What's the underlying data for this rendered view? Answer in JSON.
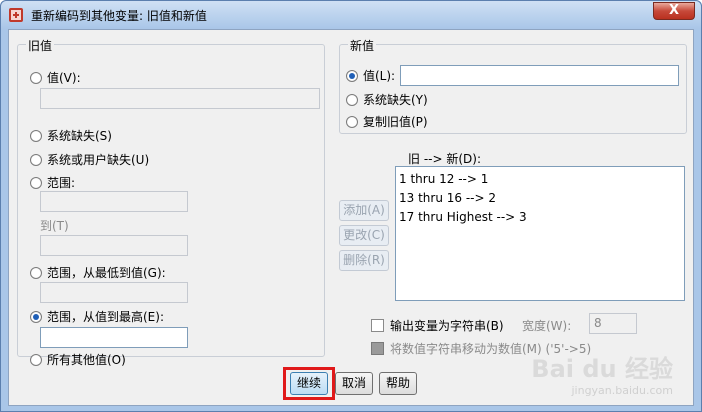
{
  "window": {
    "title": "重新编码到其他变量: 旧值和新值",
    "close_glyph": "X"
  },
  "old_value": {
    "group_title": "旧值",
    "value_label": "值(V):",
    "system_missing_label": "系统缺失(S)",
    "system_or_user_missing_label": "系统或用户缺失(U)",
    "range_label": "范围:",
    "to_label": "到(T)",
    "range_lowest_label": "范围，从最低到值(G):",
    "range_highest_label": "范围，从值到最高(E):",
    "all_other_label": "所有其他值(O)",
    "selected": "range_highest"
  },
  "new_value": {
    "group_title": "新值",
    "value_label": "值(L):",
    "system_missing_label": "系统缺失(Y)",
    "copy_old_label": "复制旧值(P)",
    "selected": "value"
  },
  "mapping": {
    "header": "旧 --> 新(D):",
    "items": [
      "1 thru 12 --> 1",
      "13 thru 16 --> 2",
      "17 thru Highest --> 3"
    ],
    "add_label": "添加(A)",
    "change_label": "更改(C)",
    "remove_label": "删除(R)"
  },
  "options": {
    "output_as_string_label": "输出变量为字符串(B)",
    "width_label": "宽度(W):",
    "width_value": "8",
    "convert_numeric_label": "将数值字符串移动为数值(M) ('5'->5)"
  },
  "buttons": {
    "continue_label": "继续",
    "cancel_label": "取消",
    "help_label": "帮助"
  },
  "watermark": {
    "brand": "Bai du 经验",
    "url": "jingyan.baidu.com"
  },
  "colors": {
    "accent": "#1f5fb7",
    "highlight_box": "#e0191a"
  }
}
